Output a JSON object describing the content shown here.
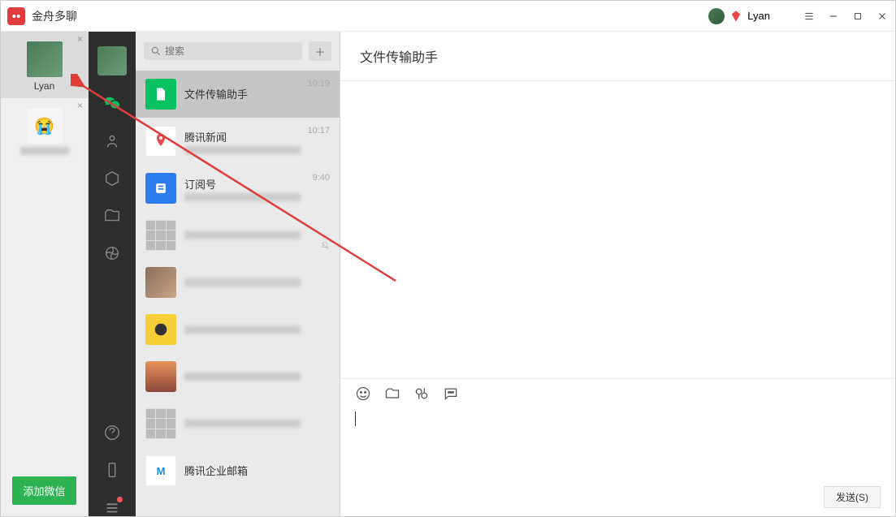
{
  "titlebar": {
    "app_name": "金舟多聊",
    "user_name": "Lyan"
  },
  "accounts": {
    "items": [
      {
        "label": "Lyan",
        "active": true
      },
      {
        "label": "",
        "active": false
      }
    ],
    "add_btn_label": "添加微信"
  },
  "search": {
    "placeholder": "搜索"
  },
  "chatlist": {
    "items": [
      {
        "name": "文件传输助手",
        "time": "10:19",
        "avatar": "file",
        "selected": true
      },
      {
        "name": "腾讯新闻",
        "time": "10:17",
        "avatar": "news"
      },
      {
        "name": "订阅号",
        "time": "9:40",
        "avatar": "sub"
      },
      {
        "name": "",
        "time": "",
        "avatar": "grid",
        "muted": true
      },
      {
        "name": "",
        "time": "",
        "avatar": "photo"
      },
      {
        "name": "",
        "time": "",
        "avatar": "yellow"
      },
      {
        "name": "",
        "time": "",
        "avatar": "sunset"
      },
      {
        "name": "",
        "time": "",
        "avatar": "grid"
      },
      {
        "name": "腾讯企业邮箱",
        "time": "",
        "avatar": "mail"
      }
    ]
  },
  "chatpane": {
    "header_title": "文件传输助手",
    "send_label": "发送(S)"
  }
}
